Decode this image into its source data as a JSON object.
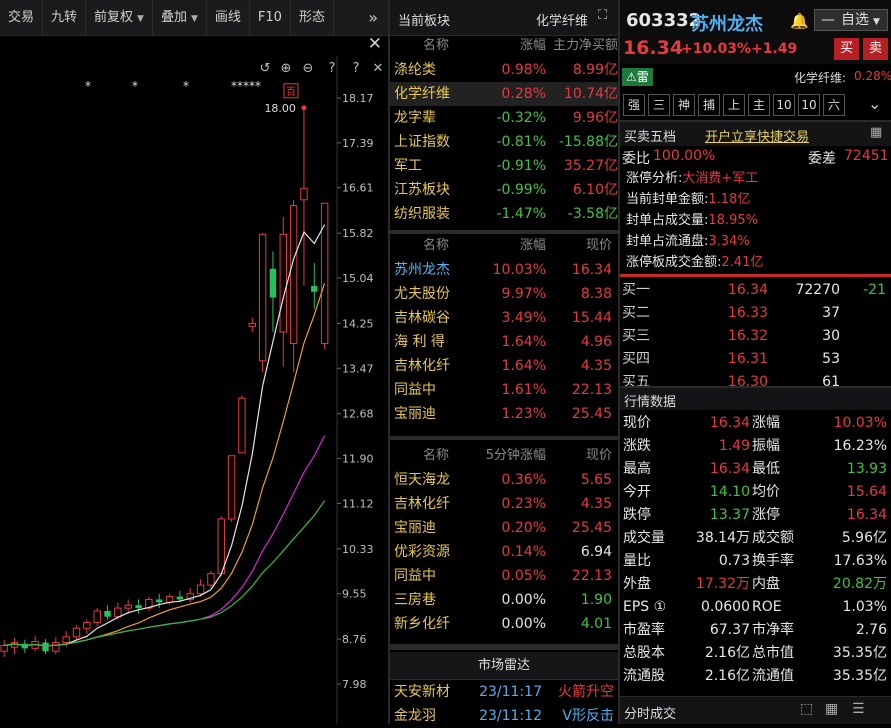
{
  "toolbar": {
    "items": [
      "交易",
      "九转",
      "前复权",
      "叠加",
      "画线",
      "F10",
      "形态"
    ],
    "more_icon": "double-chevron-right"
  },
  "chart": {
    "y_ticks": [
      "18.17",
      "17.39",
      "16.61",
      "15.82",
      "15.04",
      "14.25",
      "13.47",
      "12.68",
      "11.90",
      "11.12",
      "10.33",
      "9.55",
      "8.76",
      "7.98"
    ],
    "high_label": "18.00",
    "high_tag": "百",
    "stars": [
      "*",
      "*",
      "*",
      "*****"
    ]
  },
  "chart_data": {
    "type": "candlestick",
    "ylim": [
      7.6,
      18.5
    ],
    "candles": [
      [
        8.55,
        8.65,
        8.45,
        8.75
      ],
      [
        8.62,
        8.7,
        8.5,
        8.78
      ],
      [
        8.68,
        8.6,
        8.52,
        8.75
      ],
      [
        8.6,
        8.72,
        8.55,
        8.82
      ],
      [
        8.7,
        8.55,
        8.5,
        8.76
      ],
      [
        8.55,
        8.7,
        8.5,
        8.8
      ],
      [
        8.7,
        8.8,
        8.62,
        8.9
      ],
      [
        8.8,
        8.95,
        8.75,
        9.0
      ],
      [
        8.95,
        9.05,
        8.85,
        9.1
      ],
      [
        9.05,
        9.25,
        8.98,
        9.3
      ],
      [
        9.25,
        9.15,
        9.1,
        9.35
      ],
      [
        9.15,
        9.3,
        9.1,
        9.4
      ],
      [
        9.3,
        9.35,
        9.2,
        9.45
      ],
      [
        9.35,
        9.3,
        9.2,
        9.45
      ],
      [
        9.3,
        9.45,
        9.25,
        9.5
      ],
      [
        9.45,
        9.4,
        9.3,
        9.55
      ],
      [
        9.4,
        9.5,
        9.35,
        9.55
      ],
      [
        9.5,
        9.45,
        9.4,
        9.6
      ],
      [
        9.45,
        9.55,
        9.4,
        9.65
      ],
      [
        9.55,
        9.7,
        9.5,
        9.8
      ],
      [
        9.7,
        9.9,
        9.65,
        9.95
      ],
      [
        9.9,
        10.85,
        9.85,
        10.9
      ],
      [
        10.85,
        11.95,
        10.8,
        11.95
      ],
      [
        12.0,
        12.95,
        12.0,
        13.0
      ],
      [
        14.2,
        14.25,
        14.1,
        14.35
      ],
      [
        13.6,
        15.8,
        13.4,
        15.82
      ],
      [
        15.2,
        14.7,
        14.1,
        15.5
      ],
      [
        14.1,
        15.8,
        13.5,
        16.1
      ],
      [
        13.9,
        16.3,
        13.4,
        16.4
      ],
      [
        16.4,
        16.6,
        14.9,
        18.0
      ],
      [
        14.9,
        14.8,
        14.5,
        15.3
      ],
      [
        13.9,
        16.34,
        13.8,
        16.34
      ]
    ],
    "ma": [
      {
        "name": "MA5",
        "color": "#e6e6e6"
      },
      {
        "name": "MA10",
        "color": "#f0a020"
      },
      {
        "name": "MA20",
        "color": "#e020e0"
      },
      {
        "name": "MA30",
        "color": "#30c030"
      }
    ]
  },
  "sector_panel": {
    "title": "当前板块",
    "badge": "化学纤维",
    "headers": [
      "名称",
      "涨幅",
      "主力净买额"
    ],
    "rows": [
      {
        "name": "涤纶类",
        "change": "0.98%",
        "net": "8.99亿",
        "dir": "up"
      },
      {
        "name": "化学纤维",
        "change": "0.28%",
        "net": "10.74亿",
        "dir": "up",
        "selected": true
      },
      {
        "name": "龙字辈",
        "change": "-0.32%",
        "net": "9.96亿",
        "dir": "down"
      },
      {
        "name": "上证指数",
        "change": "-0.81%",
        "net": "-15.88亿",
        "dir": "down"
      },
      {
        "name": "军工",
        "change": "-0.91%",
        "net": "35.27亿",
        "dir": "down"
      },
      {
        "name": "江苏板块",
        "change": "-0.99%",
        "net": "6.10亿",
        "dir": "down"
      },
      {
        "name": "纺织服装",
        "change": "-1.47%",
        "net": "-3.58亿",
        "dir": "down"
      }
    ]
  },
  "stock_list": {
    "headers": [
      "名称",
      "涨幅",
      "现价"
    ],
    "rows": [
      {
        "name": "苏州龙杰",
        "change": "10.03%",
        "price": "16.34",
        "current": true
      },
      {
        "name": "尤夫股份",
        "change": "9.97%",
        "price": "8.38"
      },
      {
        "name": "吉林碳谷",
        "change": "3.49%",
        "price": "15.44"
      },
      {
        "name": "海 利 得",
        "change": "1.64%",
        "price": "4.96"
      },
      {
        "name": "吉林化纤",
        "change": "1.64%",
        "price": "4.35"
      },
      {
        "name": "同益中",
        "change": "1.61%",
        "price": "22.13"
      },
      {
        "name": "宝丽迪",
        "change": "1.23%",
        "price": "25.45"
      }
    ]
  },
  "five_min": {
    "headers": [
      "名称",
      "5分钟涨幅",
      "现价"
    ],
    "rows": [
      {
        "name": "恒天海龙",
        "change": "0.36%",
        "price": "5.65",
        "pdir": "up"
      },
      {
        "name": "吉林化纤",
        "change": "0.23%",
        "price": "4.35",
        "pdir": "up"
      },
      {
        "name": "宝丽迪",
        "change": "0.20%",
        "price": "25.45",
        "pdir": "up"
      },
      {
        "name": "优彩资源",
        "change": "0.14%",
        "price": "6.94",
        "pdir": "flat"
      },
      {
        "name": "同益中",
        "change": "0.05%",
        "price": "22.13",
        "pdir": "up"
      },
      {
        "name": "三房巷",
        "change": "0.00%",
        "price": "1.90",
        "pdir": "down"
      },
      {
        "name": "新乡化纤",
        "change": "0.00%",
        "price": "4.01",
        "pdir": "down"
      }
    ]
  },
  "radar": {
    "title": "市场雷达",
    "rows": [
      {
        "name": "天安新材",
        "time": "23/11:17",
        "event": "火箭升空"
      },
      {
        "name": "金龙羽",
        "time": "23/11:12",
        "event": "V形反击"
      }
    ]
  },
  "stock": {
    "code": "603332",
    "name": "苏州龙杰",
    "price": "16.34",
    "pct": "+10.03%",
    "chg": "+1.49",
    "watch_label": "自选",
    "buy_label": "买",
    "sell_label": "卖",
    "thunder_label": "雷",
    "sector": "化学纤维:",
    "sector_pct": "0.28%",
    "strip": [
      "强",
      "三",
      "神",
      "捕",
      "上",
      "主",
      "10",
      "10",
      "六"
    ]
  },
  "orderbook": {
    "title": "买卖五档",
    "link": "开户立享快捷交易",
    "weibi_label": "委比",
    "weibi": "100.00%",
    "weicha_label": "委差",
    "weicha": "72451",
    "limit_analysis": [
      {
        "label": "涨停分析:",
        "value": "大消费+军工"
      },
      {
        "label": "当前封单金额:",
        "value": "1.18亿"
      },
      {
        "label": "封单占成交量:",
        "value": "18.95%"
      },
      {
        "label": "封单占流通盘:",
        "value": "3.34%"
      },
      {
        "label": "涨停板成交金额:",
        "value": "2.41亿"
      }
    ],
    "bids": [
      {
        "label": "买一",
        "price": "16.34",
        "vol": "72270",
        "chg": "-21"
      },
      {
        "label": "买二",
        "price": "16.33",
        "vol": "37",
        "chg": ""
      },
      {
        "label": "买三",
        "price": "16.32",
        "vol": "30",
        "chg": ""
      },
      {
        "label": "买四",
        "price": "16.31",
        "vol": "53",
        "chg": ""
      },
      {
        "label": "买五",
        "price": "16.30",
        "vol": "61",
        "chg": ""
      }
    ]
  },
  "quote": {
    "title": "行情数据",
    "rows": [
      [
        {
          "k": "现价",
          "v": "16.34",
          "c": "red"
        },
        {
          "k": "涨幅",
          "v": "10.03%",
          "c": "red"
        }
      ],
      [
        {
          "k": "涨跌",
          "v": "1.49",
          "c": "red"
        },
        {
          "k": "振幅",
          "v": "16.23%",
          "c": "white"
        }
      ],
      [
        {
          "k": "最高",
          "v": "16.34",
          "c": "red"
        },
        {
          "k": "最低",
          "v": "13.93",
          "c": "green"
        }
      ],
      [
        {
          "k": "今开",
          "v": "14.10",
          "c": "green"
        },
        {
          "k": "均价",
          "v": "15.64",
          "c": "red"
        }
      ],
      [
        {
          "k": "跌停",
          "v": "13.37",
          "c": "green"
        },
        {
          "k": "涨停",
          "v": "16.34",
          "c": "red"
        }
      ],
      [
        {
          "k": "成交量",
          "v": "38.14万",
          "c": "white"
        },
        {
          "k": "成交额",
          "v": "5.96亿",
          "c": "white"
        }
      ],
      [
        {
          "k": "量比",
          "v": "0.73",
          "c": "white"
        },
        {
          "k": "换手率",
          "v": "17.63%",
          "c": "white"
        }
      ],
      [
        {
          "k": "外盘",
          "v": "17.32万",
          "c": "red"
        },
        {
          "k": "内盘",
          "v": "20.82万",
          "c": "green"
        }
      ],
      [
        {
          "k": "EPS ①",
          "v": "0.0600",
          "c": "white"
        },
        {
          "k": "ROE",
          "v": "1.03%",
          "c": "white"
        }
      ],
      [
        {
          "k": "市盈率",
          "v": "67.37",
          "c": "white"
        },
        {
          "k": "市净率",
          "v": "2.76",
          "c": "white"
        }
      ],
      [
        {
          "k": "总股本",
          "v": "2.16亿",
          "c": "white"
        },
        {
          "k": "总市值",
          "v": "35.35亿",
          "c": "white"
        }
      ],
      [
        {
          "k": "流通股",
          "v": "2.16亿",
          "c": "white"
        },
        {
          "k": "流通值",
          "v": "35.35亿",
          "c": "white"
        }
      ]
    ],
    "footer": "分时成交"
  }
}
